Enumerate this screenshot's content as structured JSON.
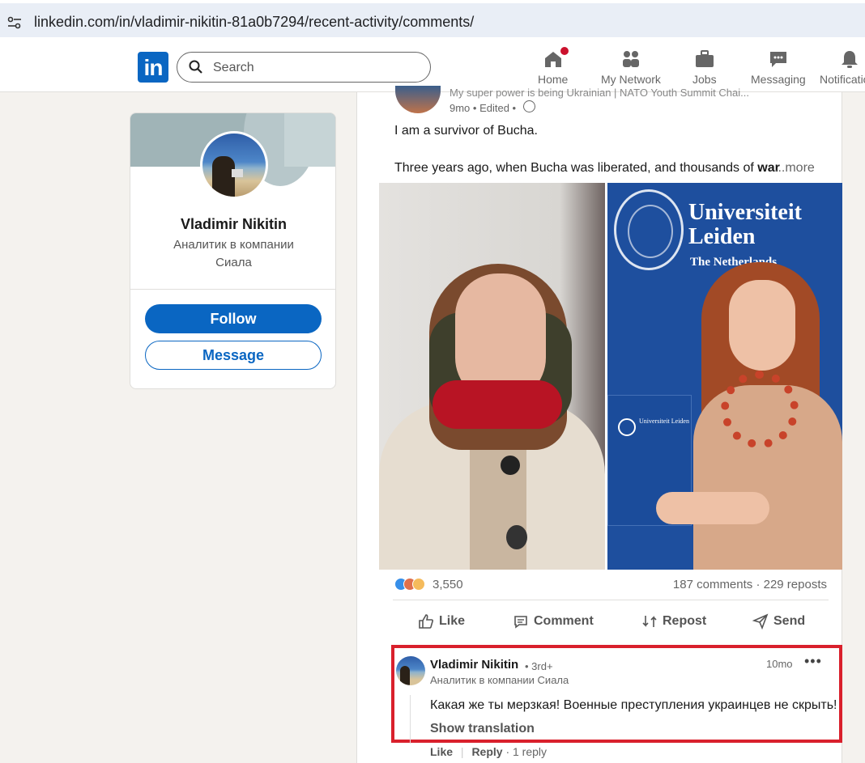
{
  "browser": {
    "url": "linkedin.com/in/vladimir-nikitin-81a0b7294/recent-activity/comments/"
  },
  "nav": {
    "logo_text": "in",
    "search_placeholder": "Search",
    "items": [
      {
        "label": "Home",
        "icon": "home-icon"
      },
      {
        "label": "My Network",
        "icon": "network-icon"
      },
      {
        "label": "Jobs",
        "icon": "briefcase-icon"
      },
      {
        "label": "Messaging",
        "icon": "messaging-icon"
      },
      {
        "label": "Notificatio",
        "icon": "bell-icon"
      }
    ]
  },
  "profile_card": {
    "name": "Vladimir Nikitin",
    "subtitle": "Аналитик в компании Сиала",
    "follow_label": "Follow",
    "message_label": "Message"
  },
  "post": {
    "author_headline": "My super power is being Ukrainian | NATO Youth Summit Chai...",
    "meta": "9mo • Edited •",
    "text_line1": "I am a survivor of Bucha.",
    "text_line2_prefix": "Three years ago, when Bucha was liberated, and thousands of",
    "text_line2_bold": "war",
    "more_label": "...more",
    "image_right_text": {
      "university": "Universiteit Leiden",
      "subtitle": "The Netherlands",
      "folder_text": "Universiteit Leiden"
    },
    "reaction_count": "3,550",
    "comments_reposts": "187 comments · 229 reposts",
    "actions": {
      "like": "Like",
      "comment": "Comment",
      "repost": "Repost",
      "send": "Send"
    }
  },
  "comment": {
    "author": "Vladimir Nikitin",
    "degree": "• 3rd+",
    "author_subtitle": "Аналитик в компании Сиала",
    "time": "10mo",
    "text": "Какая же ты мерзкая! Военные преступления украинцев не скрыть!",
    "show_translation": "Show translation",
    "like_label": "Like",
    "reply_label": "Reply",
    "reply_count": "· 1 reply"
  },
  "colors": {
    "linkedin_blue": "#0a66c2",
    "highlight_red": "#d9202c",
    "page_bg": "#f4f2ee"
  }
}
